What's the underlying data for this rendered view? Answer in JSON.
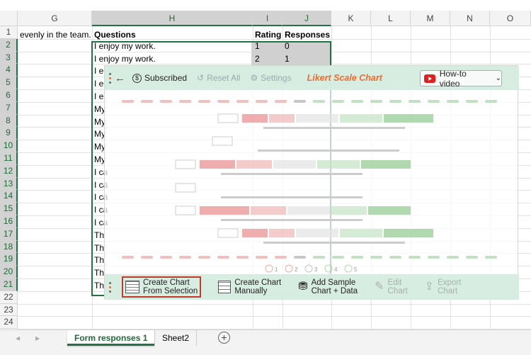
{
  "columns": [
    "G",
    "H",
    "I",
    "J",
    "K",
    "L",
    "M",
    "N",
    "O"
  ],
  "rows": [
    "1",
    "2",
    "3",
    "4",
    "5",
    "6",
    "7",
    "8",
    "9",
    "10",
    "11",
    "12",
    "13",
    "14",
    "15",
    "16",
    "17",
    "18",
    "19",
    "20",
    "21",
    "22",
    "23",
    "24"
  ],
  "row1": {
    "g": "evenly in the team.",
    "h": "Questions",
    "i": "Rating",
    "j": "Responses"
  },
  "data_rows": [
    {
      "h": "I enjoy my work.",
      "i": "1",
      "j": "0"
    },
    {
      "h": "I enjoy my work.",
      "i": "2",
      "j": "1"
    },
    {
      "h": "I e"
    },
    {
      "h": "I e"
    },
    {
      "h": "I e"
    },
    {
      "h": "My"
    },
    {
      "h": "My"
    },
    {
      "h": "My"
    },
    {
      "h": "My"
    },
    {
      "h": "My"
    },
    {
      "h": "I ca"
    },
    {
      "h": "I ca"
    },
    {
      "h": "I ca"
    },
    {
      "h": "I ca"
    },
    {
      "h": "I ca"
    },
    {
      "h": "Th"
    },
    {
      "h": "Th"
    },
    {
      "h": "Th"
    },
    {
      "h": "Th"
    },
    {
      "h": "Th"
    }
  ],
  "panel": {
    "back": "←",
    "subscribed": "Subscribed",
    "reset": "Reset All",
    "settings": "Settings",
    "title": "Likert Scale Chart",
    "howto": "How-to video",
    "create_selection_1": "Create Chart",
    "create_selection_2": "From Selection",
    "create_manual_1": "Create Chart",
    "create_manual_2": "Manually",
    "add_sample_1": "Add Sample",
    "add_sample_2": "Chart + Data",
    "edit_1": "Edit",
    "edit_2": "Chart",
    "export_1": "Export",
    "export_2": "Chart",
    "scale": [
      "1",
      "2",
      "3",
      "4",
      "5"
    ]
  },
  "tabs": {
    "sheet1": "Form responses 1",
    "sheet2": "Sheet2",
    "add": "+"
  },
  "colors": {
    "accent": "#217346",
    "title": "#ee6d2d",
    "neg": "#e88a8a",
    "pos": "#8fc98f"
  }
}
